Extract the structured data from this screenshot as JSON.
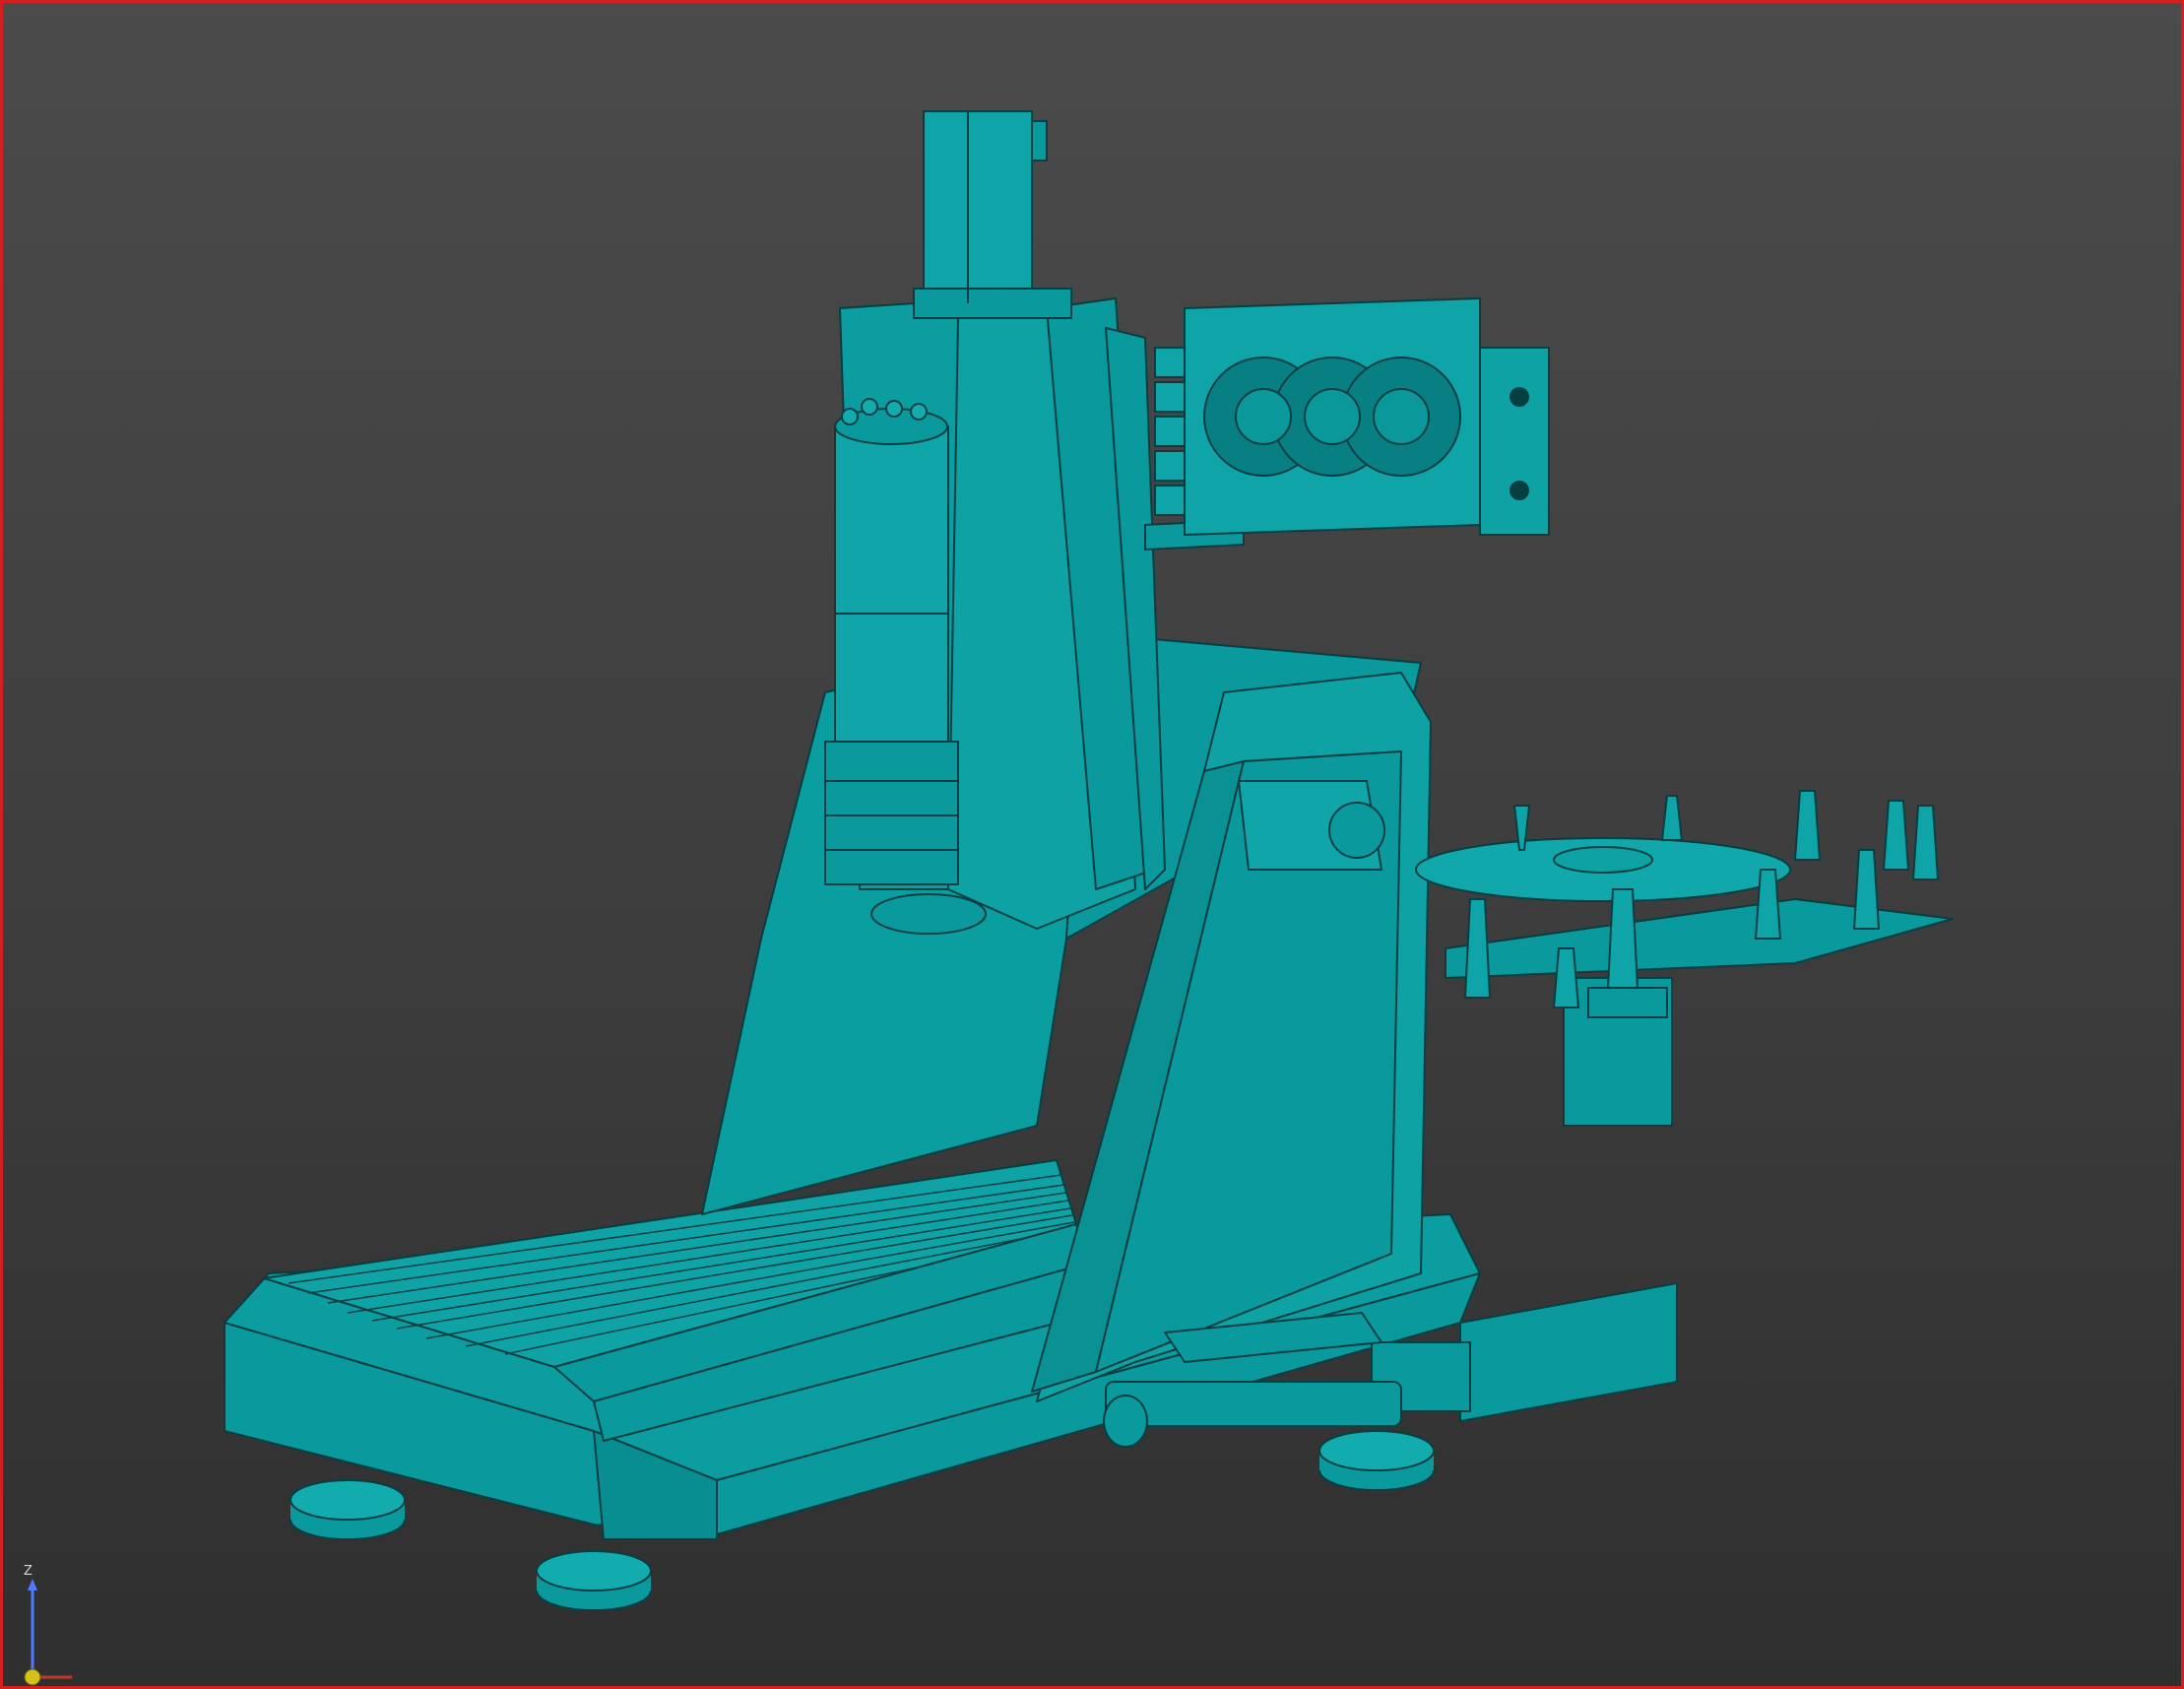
{
  "viewer": {
    "background": "#3f3f3f",
    "border_color": "#d41f1f",
    "model_color": "#0a9a9e",
    "edge_color": "#063f42"
  },
  "triad": {
    "axis_label": "Z",
    "icon": "axis-triad-icon"
  }
}
